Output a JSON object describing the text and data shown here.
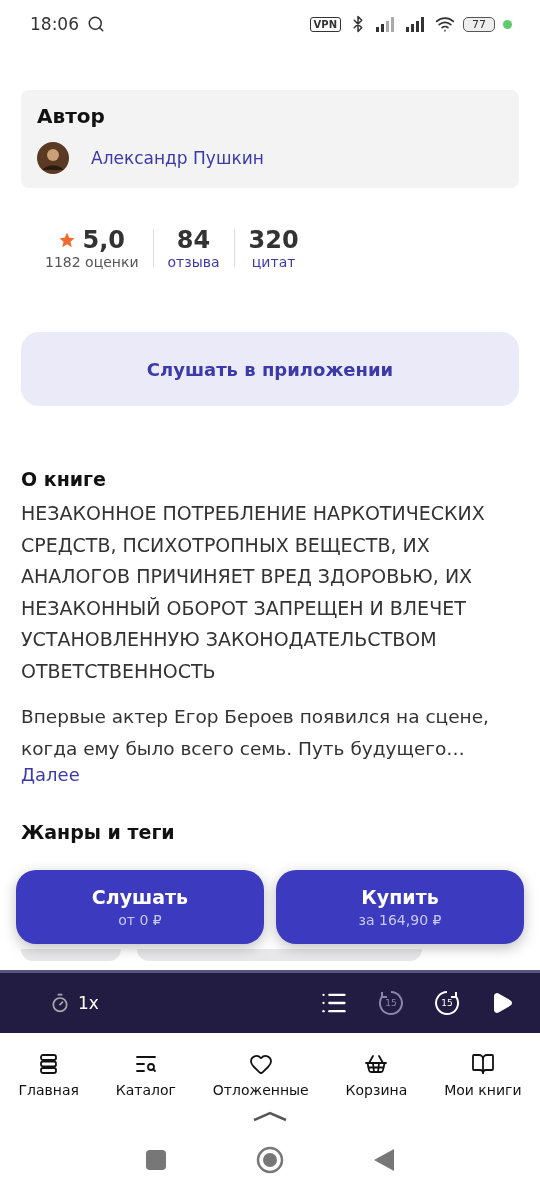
{
  "status_bar": {
    "time": "18:06",
    "vpn": "VPN",
    "battery": "77"
  },
  "author_section": {
    "title": "Автор",
    "author": "Александр Пушкин"
  },
  "stats": [
    {
      "kind": "rating",
      "value": "5,0",
      "label": "1182 оценки"
    },
    {
      "kind": "link",
      "value": "84",
      "label": "отзыва"
    },
    {
      "kind": "link",
      "value": "320",
      "label": "цитат"
    }
  ],
  "app_button": "Слушать в приложении",
  "about": {
    "title": "О книге",
    "warning": "НЕЗАКОННОЕ ПОТРЕБЛЕНИЕ НАРКОТИЧЕСКИХ СРЕДСТВ, ПСИХОТРОПНЫХ ВЕЩЕСТВ, ИХ АНАЛОГОВ ПРИЧИНЯЕТ ВРЕД ЗДОРОВЬЮ, ИХ НЕЗАКОННЫЙ ОБОРОТ ЗАПРЕЩЕН И ВЛЕЧЕТ УСТАНОВЛЕННУЮ ЗАКОНОДАТЕЛЬСТВОМ ОТВЕТСТВЕННОСТЬ",
    "description": "Впервые актер Егор Бероев появился на сцене, когда ему было всего семь. Путь будущего…",
    "more": "Далее"
  },
  "genres": {
    "title": "Жанры и теги"
  },
  "actions": [
    {
      "title": "Слушать",
      "subtitle": "от 0 ₽"
    },
    {
      "title": "Купить",
      "subtitle": "за 164,90 ₽"
    }
  ],
  "player": {
    "speed": "1x",
    "rewind": "15",
    "forward": "15"
  },
  "nav": [
    {
      "kind": "home",
      "label": "Главная"
    },
    {
      "kind": "catalog",
      "label": "Каталог"
    },
    {
      "kind": "saved",
      "label": "Отложенные"
    },
    {
      "kind": "cart",
      "label": "Корзина"
    },
    {
      "kind": "books",
      "label": "Мои книги"
    }
  ]
}
